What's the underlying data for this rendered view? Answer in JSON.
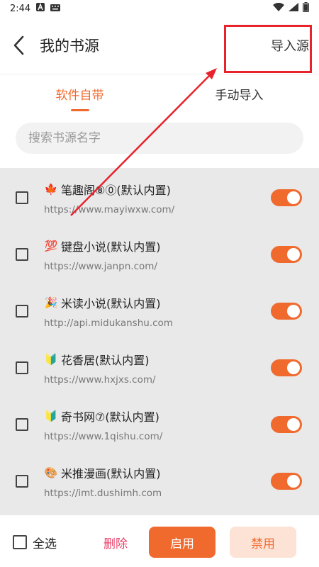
{
  "status_bar": {
    "time": "2:44"
  },
  "header": {
    "title": "我的书源",
    "import_label": "导入源"
  },
  "tabs": [
    {
      "label": "软件自带",
      "active": true
    },
    {
      "label": "手动导入",
      "active": false
    }
  ],
  "search": {
    "placeholder": "搜索书源名字"
  },
  "sources": [
    {
      "emoji": "🍁",
      "name": "笔趣阁⑧⓪(默认内置)",
      "url": "https://www.mayiwxw.com/",
      "enabled": true
    },
    {
      "emoji": "💯",
      "name": "键盘小说(默认内置)",
      "url": "https://www.janpn.com/",
      "enabled": true
    },
    {
      "emoji": "🎉",
      "name": "米读小说(默认内置)",
      "url": "http://api.midukanshu.com",
      "enabled": true
    },
    {
      "emoji": "🔰",
      "name": "花香居(默认内置)",
      "url": "https://www.hxjxs.com/",
      "enabled": true
    },
    {
      "emoji": "🔰",
      "name": "奇书网⑦(默认内置)",
      "url": "https://www.1qishu.com/",
      "enabled": true
    },
    {
      "emoji": "🎨",
      "name": "米推漫画(默认内置)",
      "url": "https://imt.dushimh.com",
      "enabled": true
    }
  ],
  "bottom": {
    "select_all_label": "全选",
    "delete_label": "删除",
    "enable_label": "启用",
    "disable_label": "禁用"
  },
  "colors": {
    "accent": "#f06a2e",
    "delete": "#e8426a",
    "highlight": "#e8232c"
  }
}
